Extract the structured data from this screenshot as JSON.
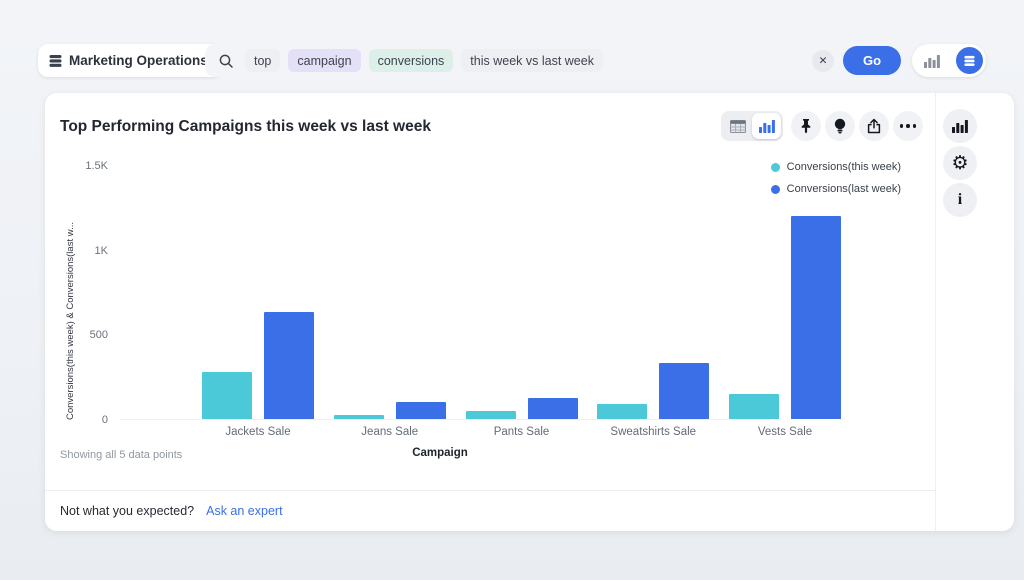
{
  "header": {
    "workspace_name": "Marketing Operations",
    "search": {
      "tokens": [
        {
          "text": "top",
          "bg": "#edeff2"
        },
        {
          "text": "campaign",
          "bg": "#e4e0f8"
        },
        {
          "text": "conversions",
          "bg": "#dcefe8"
        },
        {
          "text": "this week vs last week",
          "bg": "#edeff2"
        }
      ],
      "clear_label": "✕",
      "go_label": "Go"
    }
  },
  "card": {
    "title": "Top Performing Campaigns this week vs last week",
    "toolbar": {
      "views": [
        "table",
        "chart"
      ],
      "active_view": "chart"
    },
    "legend": [
      {
        "label": "Conversions(this week)",
        "color": "#4cc9d9"
      },
      {
        "label": "Conversions(last week)",
        "color": "#3a6fe8"
      }
    ],
    "showing_text": "Showing all 5 data points",
    "footer": {
      "question": "Not what you expected?",
      "link": "Ask an expert"
    }
  },
  "chart_data": {
    "type": "bar",
    "title": "Top Performing Campaigns this week vs last week",
    "categories": [
      "Jackets Sale",
      "Jeans Sale",
      "Pants Sale",
      "Sweatshirts Sale",
      "Vests Sale"
    ],
    "series": [
      {
        "name": "Conversions(this week)",
        "color": "#4cc9d9",
        "values": [
          280,
          25,
          45,
          90,
          150
        ]
      },
      {
        "name": "Conversions(last week)",
        "color": "#3a6fe8",
        "values": [
          630,
          100,
          125,
          330,
          1200
        ]
      }
    ],
    "xlabel": "Campaign",
    "ylabel": "Conversions(this week) & Conversions(last w...",
    "ylim": [
      0,
      1500
    ],
    "yticks": [
      {
        "label": "0",
        "value": 0
      },
      {
        "label": "500",
        "value": 500
      },
      {
        "label": "1K",
        "value": 1000
      },
      {
        "label": "1.5K",
        "value": 1500
      }
    ],
    "grid": false,
    "legend_position": "top-right"
  },
  "colors": {
    "accent_blue": "#3a6fe8",
    "teal": "#4cc9d9"
  }
}
